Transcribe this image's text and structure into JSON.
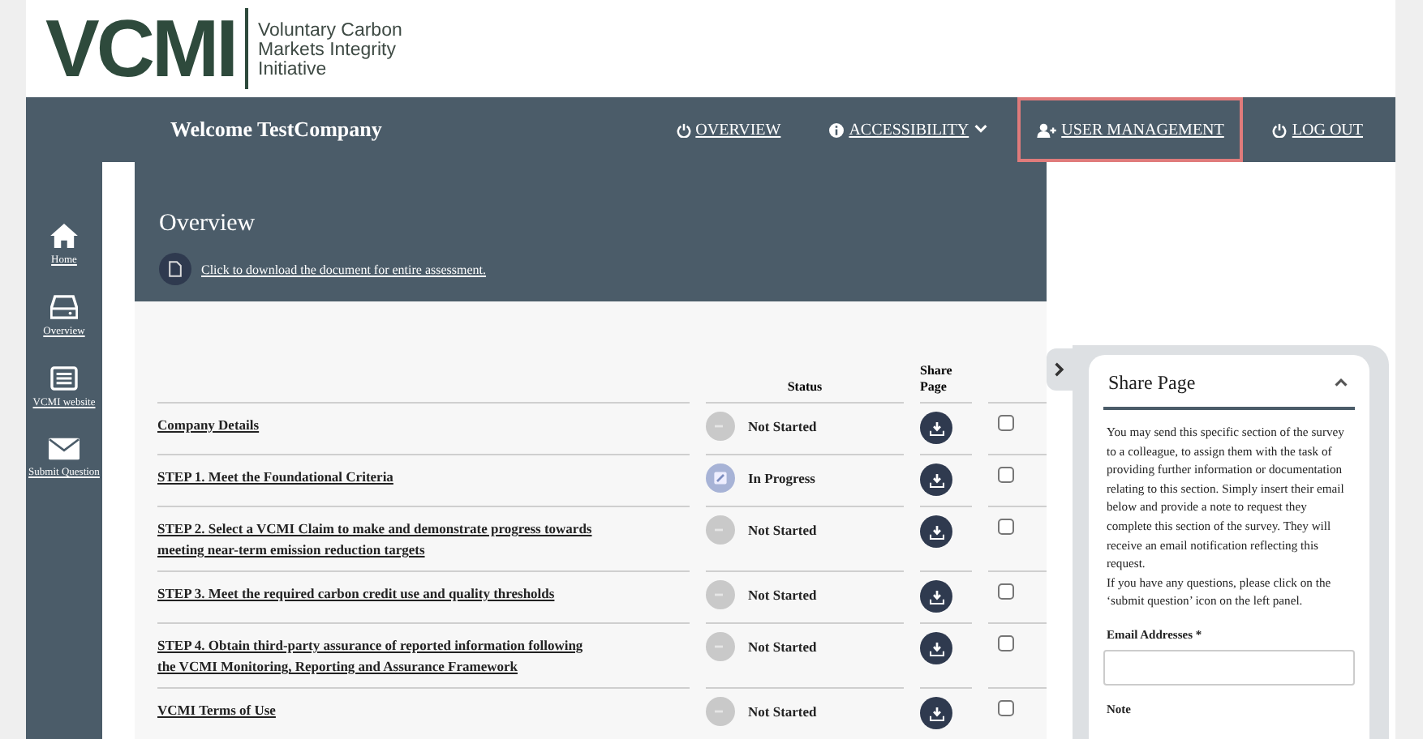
{
  "logo": {
    "mark": "VCMI",
    "tagline": [
      "Voluntary Carbon",
      "Markets Integrity",
      "Initiative"
    ]
  },
  "nav": {
    "welcome": "Welcome TestCompany",
    "items": [
      {
        "label": "OVERVIEW",
        "dropdown": false,
        "highlighted": false
      },
      {
        "label": "ACCESSIBILITY",
        "dropdown": true,
        "highlighted": false
      },
      {
        "label": "USER MANAGEMENT",
        "dropdown": false,
        "highlighted": true
      },
      {
        "label": "LOG OUT",
        "dropdown": false,
        "highlighted": false
      }
    ]
  },
  "sidebar": {
    "items": [
      {
        "label": "Home"
      },
      {
        "label": "Overview"
      },
      {
        "label": "VCMI website"
      },
      {
        "label": "Submit Question"
      }
    ]
  },
  "overview": {
    "title": "Overview",
    "download_link": "Click to download the document for entire assessment."
  },
  "table": {
    "columns": [
      "Status",
      "Share Page"
    ],
    "rows": [
      {
        "title": "Company Details",
        "status": {
          "kind": "not_started",
          "label": "Not Started"
        },
        "checked": false
      },
      {
        "title": "STEP 1. Meet the Foundational Criteria",
        "status": {
          "kind": "in_progress",
          "label": "In Progress"
        },
        "checked": false
      },
      {
        "title": "STEP 2. Select a VCMI Claim to make and demonstrate progress towards meeting near-term emission reduction targets",
        "status": {
          "kind": "not_started",
          "label": "Not Started"
        },
        "checked": false
      },
      {
        "title": "STEP 3. Meet the required carbon credit use and quality thresholds",
        "status": {
          "kind": "not_started",
          "label": "Not Started"
        },
        "checked": false
      },
      {
        "title": "STEP 4. Obtain third-party assurance of reported information following the VCMI Monitoring, Reporting and Assurance Framework",
        "status": {
          "kind": "not_started",
          "label": "Not Started"
        },
        "checked": false
      },
      {
        "title": "VCMI Terms of Use",
        "status": {
          "kind": "not_started",
          "label": "Not Started"
        },
        "checked": false
      }
    ]
  },
  "share_panel": {
    "title": "Share Page",
    "expanded": true,
    "paragraphs": [
      "You may send this specific section of the survey to a colleague, to assign them with the task of providing further information or documentation relating to this section. Simply insert their email below and provide a note to request they complete this section of the survey. They will receive an email notification reflecting this request.",
      "If you have any questions, please click on the ‘submit question’ icon on the left panel."
    ],
    "email_label": "Email Addresses *",
    "note_label": "Note"
  }
}
